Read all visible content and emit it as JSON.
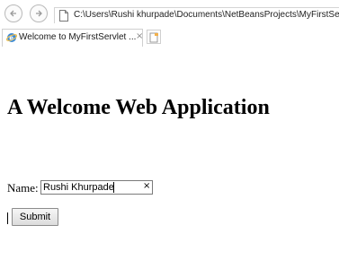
{
  "browser": {
    "address": "C:\\Users\\Rushi khurpade\\Documents\\NetBeansProjects\\MyFirstServle",
    "tab_title": "Welcome to MyFirstServlet ...",
    "tab_close": "×"
  },
  "page": {
    "heading": "A Welcome Web Application",
    "name_label": "Name:",
    "name_value": "Rushi Khurpade",
    "clear_glyph": "×",
    "submit_label": "Submit"
  },
  "icons": {
    "back": "back-arrow-icon",
    "forward": "forward-arrow-icon",
    "page": "page-icon",
    "ie": "internet-explorer-icon",
    "new_tab": "new-tab-icon"
  }
}
